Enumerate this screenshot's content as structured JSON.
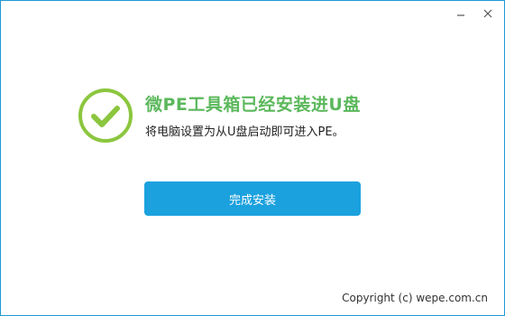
{
  "window": {
    "controls": [
      {
        "name": "minimize-icon"
      },
      {
        "name": "close-icon"
      }
    ],
    "accent_color": "#1e9ad6"
  },
  "result": {
    "icon": "checkmark-circle-icon",
    "icon_color": "#8cc63f",
    "title": "微PE工具箱已经安装进U盘",
    "title_color": "#5cb85c",
    "message": "将电脑设置为从U盘启动即可进入PE。"
  },
  "actions": {
    "finish_label": "完成安装",
    "button_color": "#1ba1de"
  },
  "footer": {
    "copyright": "Copyright (c) wepe.com.cn"
  }
}
